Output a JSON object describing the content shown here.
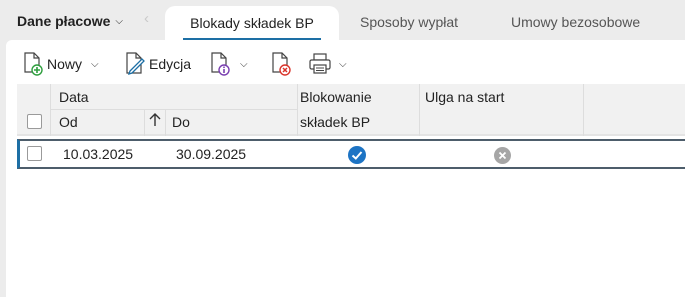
{
  "tabs": {
    "dropdown_label": "Dane płacowe",
    "active_label": "Blokady składek BP",
    "tab2_label": "Sposoby wypłat",
    "tab3_label": "Umowy bezosobowe"
  },
  "toolbar": {
    "new_label": "Nowy",
    "edit_label": "Edycja"
  },
  "grid": {
    "group_header": "Data",
    "col_from": "Od",
    "col_to": "Do",
    "col_block_line1": "Blokowanie",
    "col_block_line2": "składek BP",
    "col_relief": "Ulga na start",
    "rows": [
      {
        "from": "10.03.2025",
        "to": "30.09.2025",
        "blocked": true,
        "relief": false
      }
    ]
  },
  "colors": {
    "accent": "#1d6fa5",
    "check_blue": "#1d74c4",
    "neutral_gray": "#a6a6a6"
  }
}
